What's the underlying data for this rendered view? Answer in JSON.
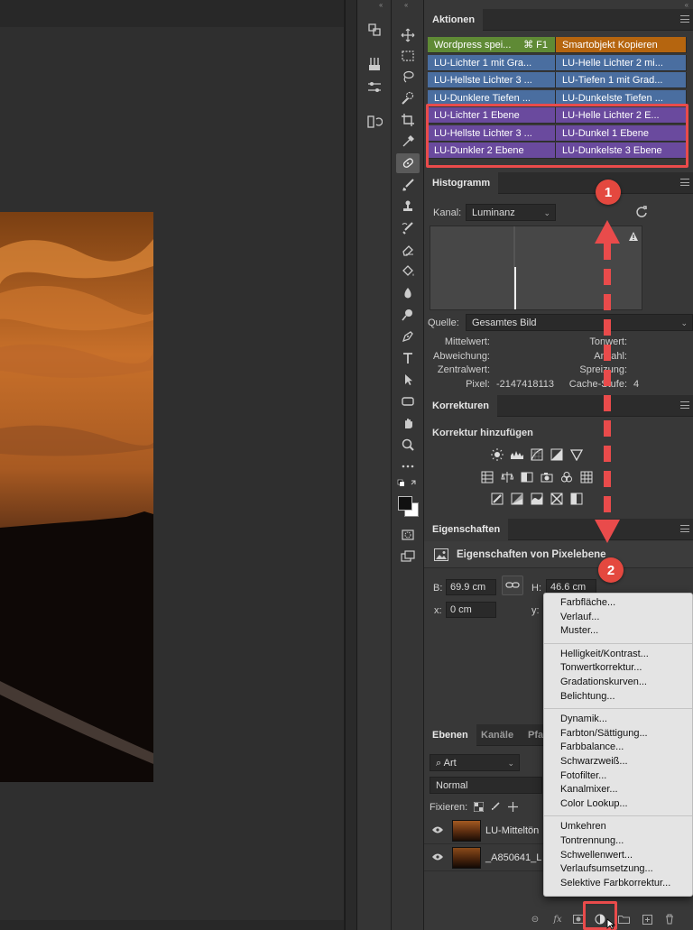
{
  "panels": {
    "actions": {
      "tab": "Aktionen",
      "items": [
        {
          "left": "Wordpress spei...",
          "left_shortcut": "⌘ F1",
          "right": "Smartobjekt Kopieren",
          "left_color": "#5f8a35",
          "right_color": "#b5650f"
        },
        {
          "left": "LU-Lichter 1 mit Gra...",
          "right": "LU-Helle Lichter 2 mi...",
          "left_color": "#4a6ea0",
          "right_color": "#4a6ea0"
        },
        {
          "left": "LU-Hellste Lichter 3 ...",
          "right": "LU-Tiefen 1 mit Grad...",
          "left_color": "#4a6ea0",
          "right_color": "#4a6ea0"
        },
        {
          "left": "LU-Dunklere Tiefen ...",
          "right": "LU-Dunkelste Tiefen ...",
          "left_color": "#4a6ea0",
          "right_color": "#4a6ea0"
        },
        {
          "left": "LU-Lichter 1 Ebene",
          "right": "LU-Helle Lichter 2 E...",
          "left_color": "#6a4a9e",
          "right_color": "#6a4a9e"
        },
        {
          "left": "LU-Hellste Lichter 3 ...",
          "right": "LU-Dunkel 1 Ebene",
          "left_color": "#6a4a9e",
          "right_color": "#6a4a9e"
        },
        {
          "left": "LU-Dunkler 2 Ebene",
          "right": "LU-Dunkelste 3 Ebene",
          "left_color": "#6a4a9e",
          "right_color": "#6a4a9e"
        }
      ]
    },
    "histogram": {
      "tab": "Histogramm",
      "channel_label": "Kanal:",
      "channel_value": "Luminanz",
      "source_label": "Quelle:",
      "source_value": "Gesamtes Bild",
      "stats_left": [
        {
          "label": "Mittelwert:",
          "value": ""
        },
        {
          "label": "Abweichung:",
          "value": ""
        },
        {
          "label": "Zentralwert:",
          "value": ""
        },
        {
          "label": "Pixel:",
          "value": "-2147418113"
        }
      ],
      "stats_right": [
        {
          "label": "Tonwert:",
          "value": ""
        },
        {
          "label": "Anzahl:",
          "value": ""
        },
        {
          "label": "Spreizung:",
          "value": ""
        },
        {
          "label": "Cache-Stufe:",
          "value": "4"
        }
      ]
    },
    "corrections": {
      "tab": "Korrekturen",
      "heading": "Korrektur hinzufügen"
    },
    "properties": {
      "tab": "Eigenschaften",
      "heading": "Eigenschaften von Pixelebene",
      "b_label": "B:",
      "b_value": "69.9 cm",
      "h_label": "H:",
      "h_value": "46.6 cm",
      "x_label": "x:",
      "x_value": "0 cm",
      "y_label": "y:"
    },
    "layers": {
      "tabs": [
        "Ebenen",
        "Kanäle",
        "Pfa"
      ],
      "filter_value": "Art",
      "blend_mode": "Normal",
      "lock_label": "Fixieren:",
      "rows": [
        {
          "name": "LU-Mitteltön"
        },
        {
          "name": "_A850641_L"
        }
      ]
    }
  },
  "context_menu": {
    "groups": [
      [
        "Farbfläche...",
        "Verlauf...",
        "Muster..."
      ],
      [
        "Helligkeit/Kontrast...",
        "Tonwertkorrektur...",
        "Gradationskurven...",
        "Belichtung..."
      ],
      [
        "Dynamik...",
        "Farbton/Sättigung...",
        "Farbbalance...",
        "Schwarzweiß...",
        "Fotofilter...",
        "Kanalmixer...",
        "Color Lookup..."
      ],
      [
        "Umkehren",
        "Tontrennung...",
        "Schwellenwert...",
        "Verlaufsumsetzung...",
        "Selektive Farbkorrektur..."
      ]
    ]
  },
  "annotations": {
    "badge1": "1",
    "badge2": "2",
    "accent_color": "#e94b4b"
  }
}
